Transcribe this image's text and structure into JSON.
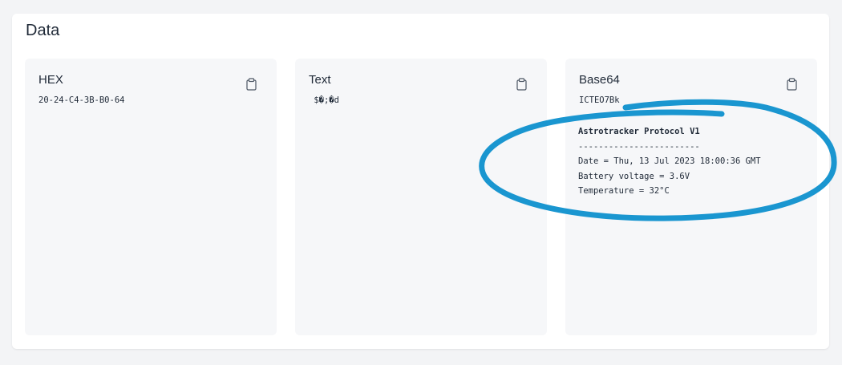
{
  "panel": {
    "title": "Data"
  },
  "cards": [
    {
      "title": "HEX",
      "value": "20-24-C4-3B-B0-64",
      "copy_icon": "clipboard-icon"
    },
    {
      "title": "Text",
      "value": " $�;�d",
      "copy_icon": "clipboard-icon"
    },
    {
      "title": "Base64",
      "value": "ICTEO7Bk",
      "copy_icon": "clipboard-icon"
    }
  ],
  "decoded": {
    "header": "Astrotracker Protocol V1",
    "separator": "------------------------",
    "date_line": "Date = Thu, 13 Jul 2023 18:00:36 GMT",
    "battery_line": "Battery voltage = 3.6V",
    "temperature_line": "Temperature = 32°C"
  },
  "colors": {
    "annotation": "#1a96d0"
  }
}
